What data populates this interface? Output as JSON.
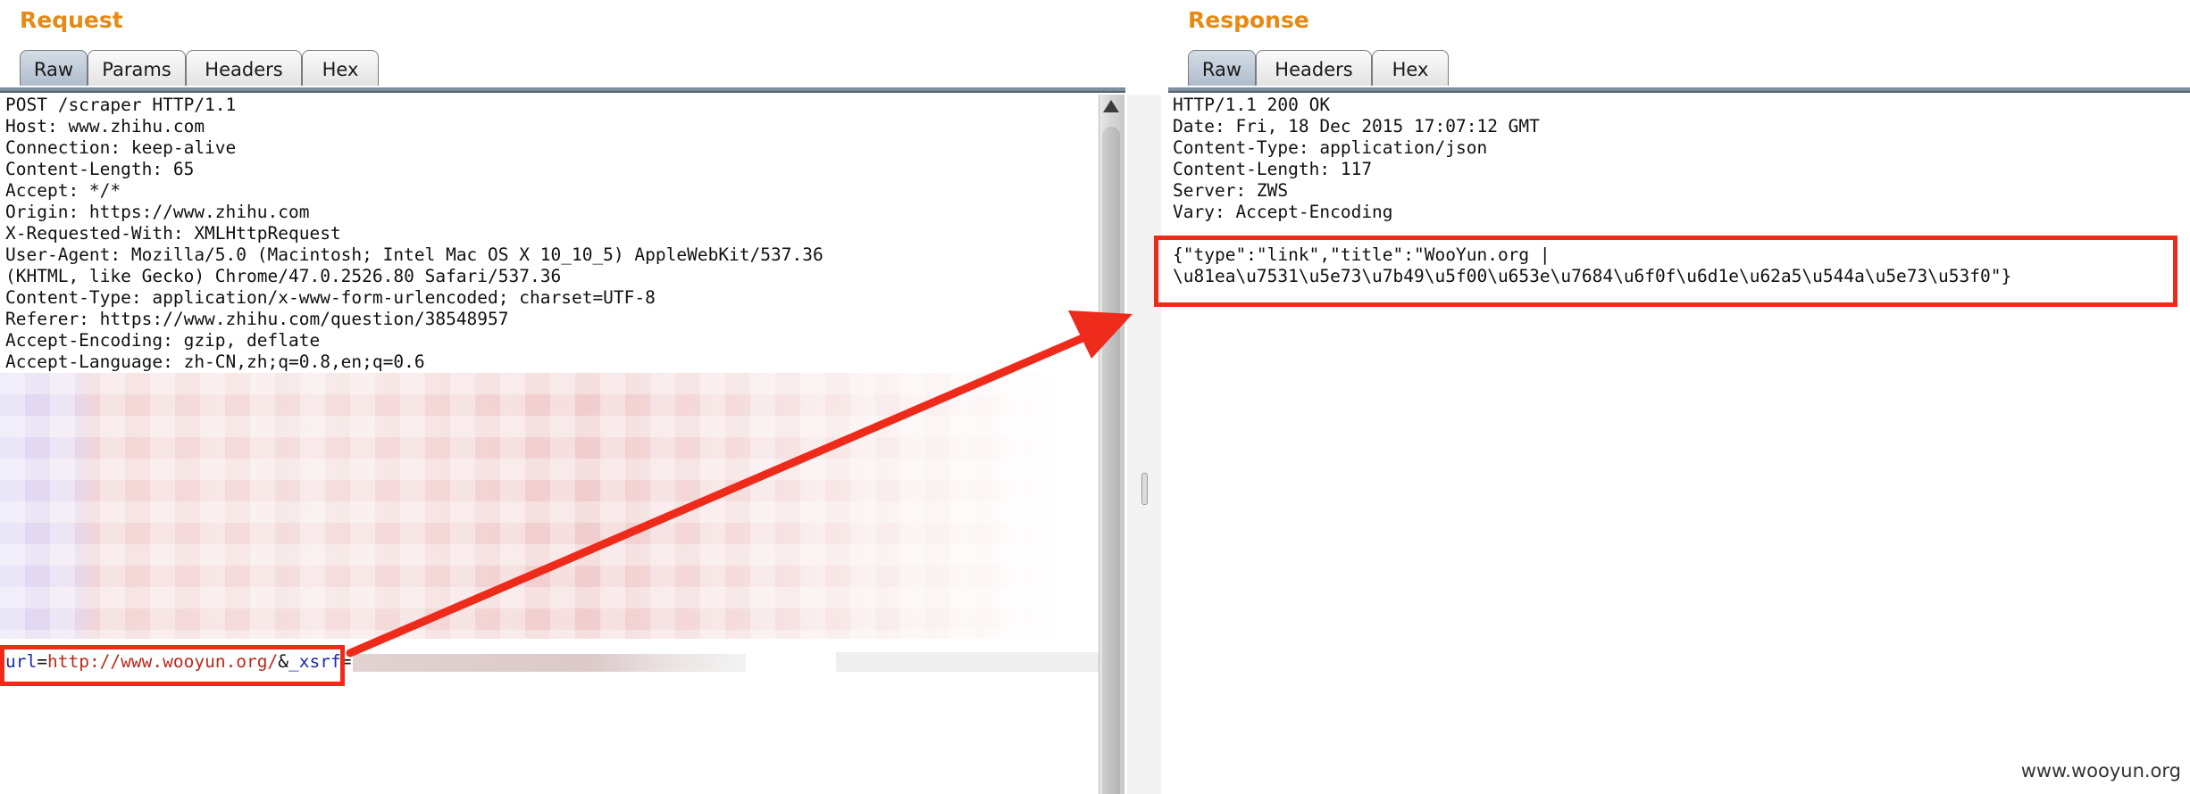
{
  "request": {
    "title": "Request",
    "tabs": [
      {
        "label": "Raw",
        "active": true
      },
      {
        "label": "Params",
        "active": false
      },
      {
        "label": "Headers",
        "active": false
      },
      {
        "label": "Hex",
        "active": false
      }
    ],
    "lines": [
      "POST /scraper HTTP/1.1",
      "Host: www.zhihu.com",
      "Connection: keep-alive",
      "Content-Length: 65",
      "Accept: */*",
      "Origin: https://www.zhihu.com",
      "X-Requested-With: XMLHttpRequest",
      "User-Agent: Mozilla/5.0 (Macintosh; Intel Mac OS X 10_10_5) AppleWebKit/537.36",
      "(KHTML, like Gecko) Chrome/47.0.2526.80 Safari/537.36",
      "Content-Type: application/x-www-form-urlencoded; charset=UTF-8",
      "Referer: https://www.zhihu.com/question/38548957",
      "Accept-Encoding: gzip, deflate",
      "Accept-Language: zh-CN,zh;q=0.8,en;q=0.6"
    ],
    "body_params": {
      "url_key": "url",
      "eq1": "=",
      "url_value": "http://www.wooyun.org/",
      "amp": "&",
      "xsrf_key": "_xsrf",
      "eq2": "="
    }
  },
  "response": {
    "title": "Response",
    "tabs": [
      {
        "label": "Raw",
        "active": true
      },
      {
        "label": "Headers",
        "active": false
      },
      {
        "label": "Hex",
        "active": false
      }
    ],
    "lines": [
      "HTTP/1.1 200 OK",
      "Date: Fri, 18 Dec 2015 17:07:12 GMT",
      "Content-Type: application/json",
      "Content-Length: 117",
      "Server: ZWS",
      "Vary: Accept-Encoding"
    ],
    "body_lines": [
      "{\"type\":\"link\",\"title\":\"WooYun.org |",
      "\\u81ea\\u7531\\u5e73\\u7b49\\u5f00\\u653e\\u7684\\u6f0f\\u6d1e\\u62a5\\u544a\\u5e73\\u53f0\"}"
    ]
  },
  "watermark": "www.wooyun.org",
  "colors": {
    "title_orange": "#e68a13",
    "highlight_red": "#ee2a1b",
    "param_key_blue": "#1c2bb0",
    "param_value_red": "#c0271a"
  },
  "icons": {
    "scroll_up": "triangle-up",
    "annotation": "arrow"
  }
}
